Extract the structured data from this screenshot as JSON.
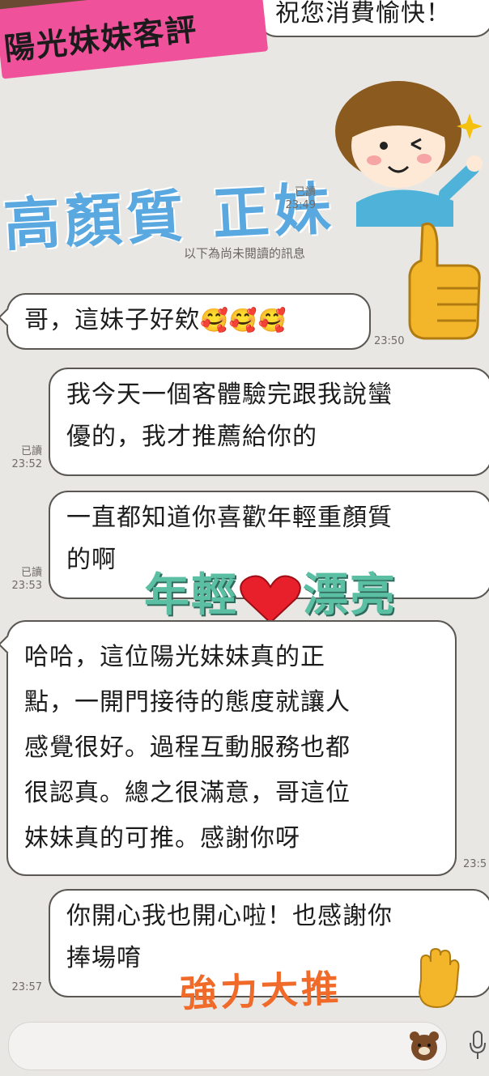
{
  "header": {
    "tag_text": "陽光妹妹客評",
    "top_message": "祝您消費愉快！"
  },
  "overlay": {
    "blue_title": "高顏質 正妹",
    "green_phrase_a": "年輕",
    "green_phrase_b": "漂亮",
    "orange_phrase": "強力大推"
  },
  "divider": {
    "text": "以下為尚未閱讀的訊息"
  },
  "messages": [
    {
      "direction": "out",
      "read": "已讀",
      "time": "23:49"
    },
    {
      "direction": "in",
      "text": "哥，這妹子好欸",
      "emoji": "🥰🥰🥰",
      "time": "23:50"
    },
    {
      "direction": "out",
      "text_line1": "我今天一個客體驗完跟我說蠻",
      "text_line2": "優的，我才推薦給你的",
      "read": "已讀",
      "time": "23:52"
    },
    {
      "direction": "out",
      "text_line1": "一直都知道你喜歡年輕重顏質",
      "text_line2": "的啊",
      "read": "已讀",
      "time": "23:53"
    },
    {
      "direction": "in",
      "lines": [
        "哈哈，這位陽光妹妹真的正",
        "點，一開門接待的態度就讓人",
        "感覺很好。過程互動服務也都",
        "很認真。總之很滿意，哥這位",
        "妹妹真的可推。感謝你呀"
      ],
      "time": "23:5"
    },
    {
      "direction": "out",
      "text_line1": "你開心我也開心啦！也感謝你",
      "text_line2": "捧場唷",
      "time": "23:57"
    }
  ],
  "colors": {
    "tag": "#f0519b",
    "blue": "#5aa8e0",
    "green": "#5bbfa3",
    "orange": "#f06b2a"
  },
  "icons": [
    "girl-sticker-icon",
    "thumbs-up-icon",
    "heart-icon",
    "raised-hand-icon",
    "bear-sticker-icon",
    "microphone-icon"
  ]
}
